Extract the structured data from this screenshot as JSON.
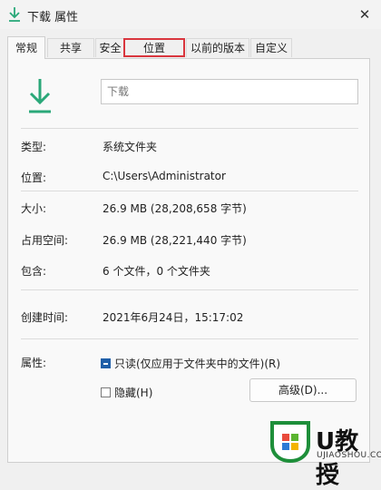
{
  "window": {
    "title": "下载 属性",
    "close_glyph": "✕"
  },
  "tabs": [
    {
      "label": "常规"
    },
    {
      "label": "共享"
    },
    {
      "label": "安全"
    },
    {
      "label": "位置"
    },
    {
      "label": "以前的版本"
    },
    {
      "label": "自定义"
    }
  ],
  "general": {
    "name_placeholder": "下载",
    "rows": {
      "type": {
        "label": "类型:",
        "value": "系统文件夹"
      },
      "location": {
        "label": "位置:",
        "value": "C:\\Users\\Administrator"
      },
      "size": {
        "label": "大小:",
        "value": "26.9 MB (28,208,658 字节)"
      },
      "disk": {
        "label": "占用空间:",
        "value": "26.9 MB (28,221,440 字节)"
      },
      "contains": {
        "label": "包含:",
        "value": "6 个文件，0 个文件夹"
      },
      "created": {
        "label": "创建时间:",
        "value": "2021年6月24日，15:17:02"
      }
    },
    "attributes": {
      "label": "属性:",
      "readonly": "只读(仅应用于文件夹中的文件)(R)",
      "hidden": "隐藏(H)",
      "advanced_button": "高级(D)..."
    }
  },
  "watermark": {
    "text": "U教授",
    "subtext": "UJIAOSHOU.COM"
  },
  "colors": {
    "icon_green": "#2aa879",
    "highlight_red": "#d9363e",
    "checkbox_blue": "#1f5fa8"
  }
}
